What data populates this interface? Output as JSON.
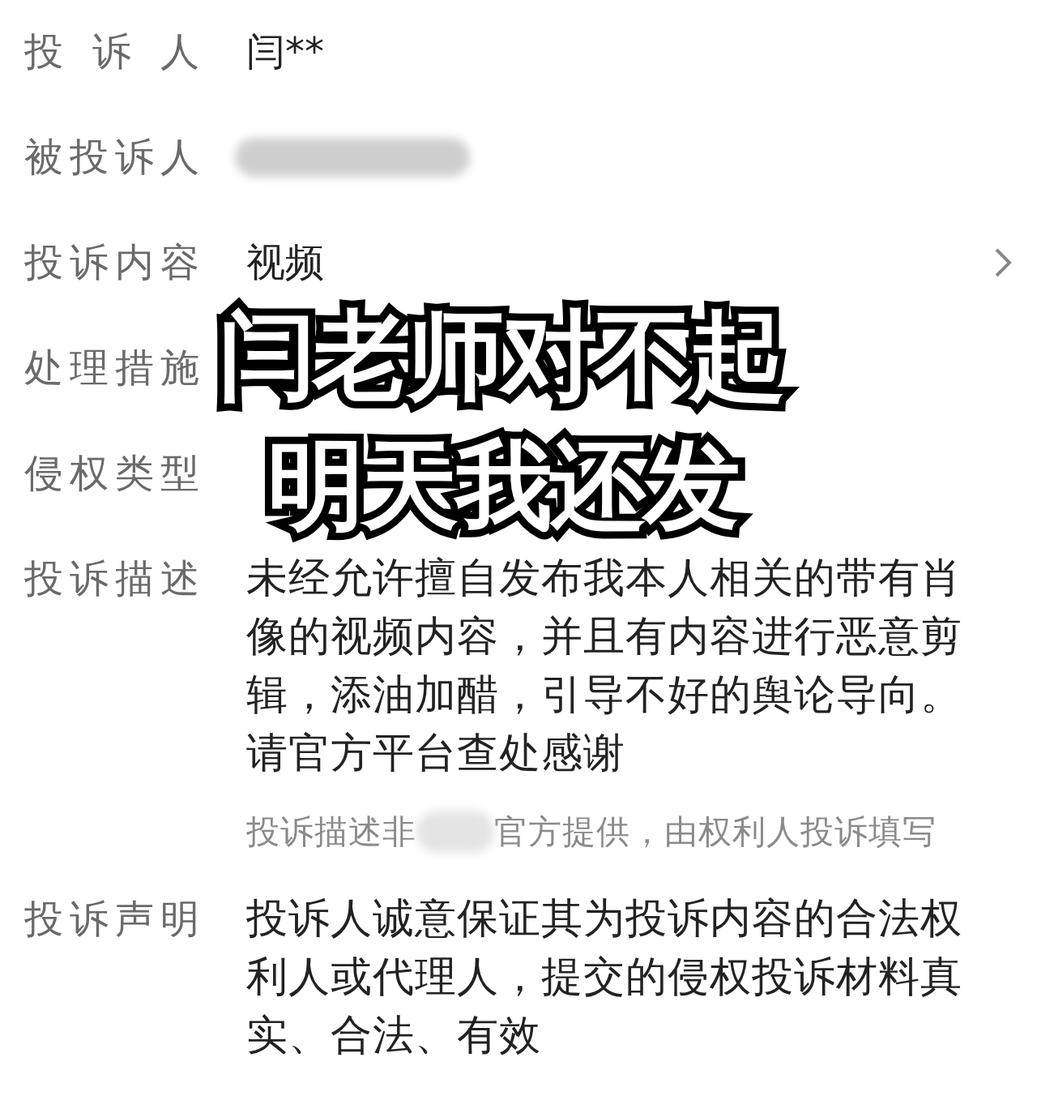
{
  "fields": [
    {
      "kind": "text",
      "label": "投诉人",
      "value": "闫**"
    },
    {
      "kind": "redacted",
      "label": "被投诉人"
    },
    {
      "kind": "link",
      "label": "投诉内容",
      "value": "视频"
    },
    {
      "kind": "text",
      "label": "处理措施"
    },
    {
      "kind": "text",
      "label": "侵权类型"
    },
    {
      "kind": "paragraph",
      "label": "投诉描述",
      "value": "未经允许擅自发布我本人相关的带有肖像的视频内容，并且有内容进行恶意剪辑，添油加醋，引导不好的舆论导向。请官方平台查处感谢",
      "note": {
        "before": "投诉描述非",
        "after": "官方提供，由权利人投诉填写"
      }
    },
    {
      "kind": "paragraph",
      "label": "投诉声明",
      "value": "投诉人诚意保证其为投诉内容的合法权利人或代理人，提交的侵权投诉材料真实、合法、有效"
    }
  ],
  "caption": [
    "闫老师对不起",
    "明天我还发"
  ]
}
